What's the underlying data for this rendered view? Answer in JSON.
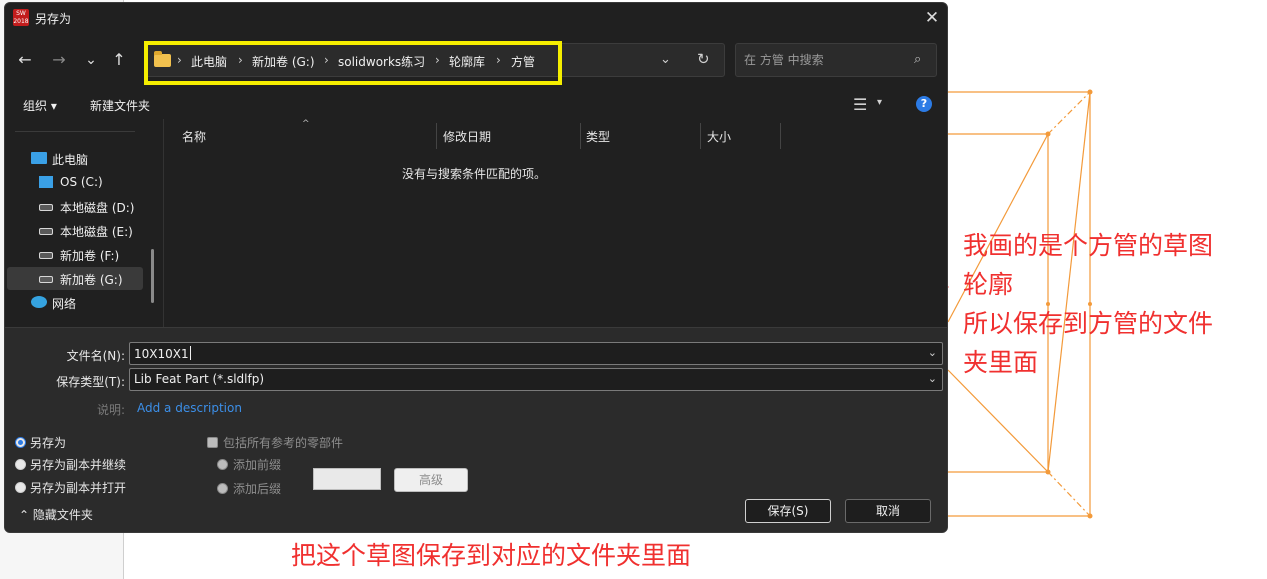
{
  "dialog": {
    "app_icon_text": "SW 2018",
    "title": "另存为",
    "close_glyph": "✕"
  },
  "nav": {
    "back": "←",
    "forward": "→",
    "recent": "⌄",
    "up": "↑"
  },
  "address": {
    "crumbs": [
      "此电脑",
      "新加卷 (G:)",
      "solidworks练习",
      "轮廓库",
      "方管"
    ],
    "separator": "›",
    "dropdown_glyph": "⌄",
    "refresh_glyph": "↻"
  },
  "search": {
    "placeholder": "在 方管 中搜索",
    "icon_glyph": "⌕"
  },
  "toolbar": {
    "organize": "组织 ▾",
    "new_folder": "新建文件夹",
    "view_glyph": "☰",
    "view_dd": "▾",
    "help_glyph": "?"
  },
  "sidebar": {
    "items": [
      {
        "label": "此电脑",
        "icon": "computer-icon"
      },
      {
        "label": "OS (C:)",
        "icon": "os-drive-icon"
      },
      {
        "label": "本地磁盘 (D:)",
        "icon": "drive-icon"
      },
      {
        "label": "本地磁盘 (E:)",
        "icon": "drive-icon"
      },
      {
        "label": "新加卷 (F:)",
        "icon": "drive-icon"
      },
      {
        "label": "新加卷 (G:)",
        "icon": "drive-icon",
        "selected": true
      },
      {
        "label": "网络",
        "icon": "network-icon"
      }
    ]
  },
  "files": {
    "columns": [
      "名称",
      "修改日期",
      "类型",
      "大小"
    ],
    "sort_glyph": "^",
    "empty_message": "没有与搜索条件匹配的项。"
  },
  "form": {
    "filename_label": "文件名(N):",
    "filename_value": "10X10X1",
    "filetype_label": "保存类型(T):",
    "filetype_value": "Lib Feat Part (*.sldlfp)",
    "description_label": "说明:",
    "description_link": "Add a description",
    "dd_glyph": "⌄"
  },
  "options": {
    "save_as": "另存为",
    "save_copy_continue": "另存为副本并继续",
    "save_copy_open": "另存为副本并打开",
    "include_refs": "包括所有参考的零部件",
    "add_prefix": "添加前缀",
    "add_suffix": "添加后缀",
    "advanced": "高级"
  },
  "buttons": {
    "save": "保存(S)",
    "cancel": "取消",
    "hide_folders": "⌃  隐藏文件夹"
  },
  "annotations": {
    "right_note_lines": [
      "我画的是个方管的草图",
      "轮廓",
      "所以保存到方管的文件",
      "夹里面"
    ],
    "bottom_note": "把这个草图保存到对应的文件夹里面"
  },
  "colors": {
    "highlight": "#f5ee00",
    "annotation": "#f0302f",
    "sketch": "#f39a3a",
    "accent": "#2c7be5"
  }
}
